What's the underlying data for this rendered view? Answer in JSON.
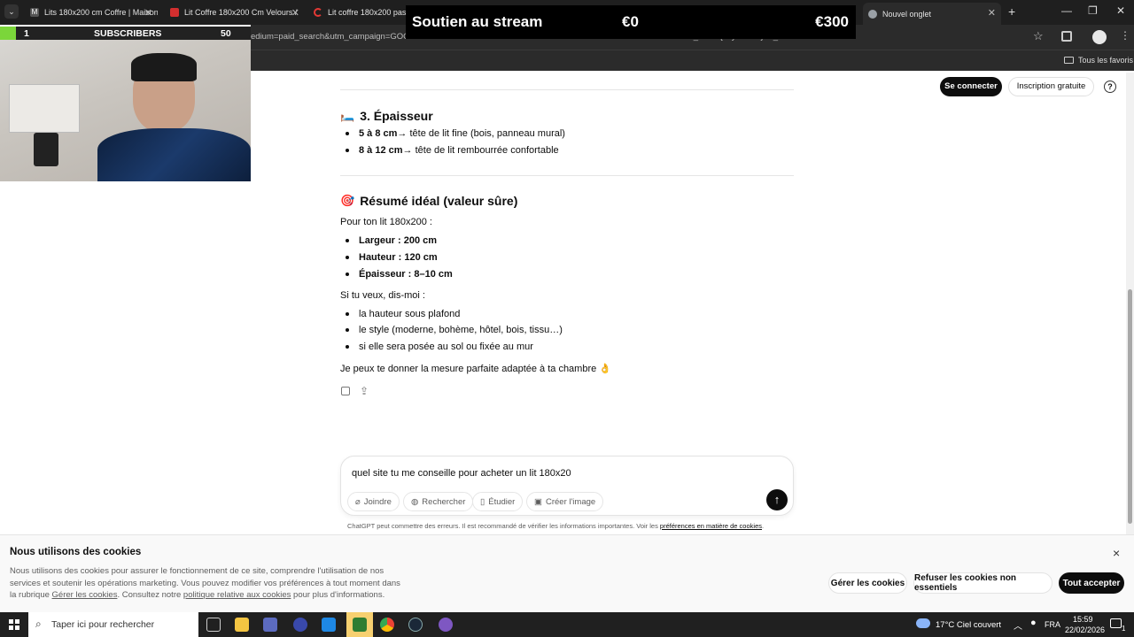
{
  "browser": {
    "tabs": [
      {
        "title": "Lits 180x200 cm Coffre | Maison"
      },
      {
        "title": "Lit Coffre 180x200 Cm Velours /"
      },
      {
        "title": "Lit coffre 180x200 pas cher"
      },
      {
        "title": "Nouvel onglet"
      }
    ],
    "new_tab": "+",
    "url": "edium=paid_search&utm_campaign=GOO...........................................................................................=785793562683&c_kwid={keywordid}&c_i...",
    "favorites_label": "Tous les favoris"
  },
  "overlay": {
    "donation_title": "Soutien au stream",
    "donation_current": "€0",
    "donation_goal": "€300",
    "subs_left": "1",
    "subs_label": "SUBSCRIBERS",
    "subs_right": "50",
    "subs_progress": 0.02
  },
  "header": {
    "login": "Se connecter",
    "signup": "Inscription gratuite",
    "help_icon": "?"
  },
  "content": {
    "section3_emoji": "🛏️",
    "section3_title": "3. Épaisseur",
    "section3_items": [
      {
        "bold": "5 à 8 cm",
        "rest": " → tête de lit fine (bois, panneau mural)"
      },
      {
        "bold": "8 à 12 cm",
        "rest": " → tête de lit rembourrée confortable"
      }
    ],
    "summary_emoji": "🎯",
    "summary_title": "Résumé idéal (valeur sûre)",
    "summary_intro": "Pour ton lit 180x200 :",
    "summary_items": [
      {
        "bold": "Largeur : 200 cm"
      },
      {
        "bold": "Hauteur : 120 cm"
      },
      {
        "bold": "Épaisseur : 8–10 cm"
      }
    ],
    "ask_intro": "Si tu veux, dis-moi :",
    "ask_items": [
      "la hauteur sous plafond",
      "le style (moderne, bohème, hôtel, bois, tissu…)",
      "si elle sera posée au sol ou fixée au mur"
    ],
    "closing": "Je peux te donner la mesure parfaite adaptée à ta chambre 👌"
  },
  "composer": {
    "value": "quel site tu me conseille pour acheter un lit 180x20",
    "tools": [
      "Joindre",
      "Rechercher",
      "Étudier",
      "Créer l'image"
    ],
    "disclaimer_main": "ChatGPT peut commettre des erreurs. Il est recommandé de vérifier les informations importantes. Voir les ",
    "disclaimer_link": "préférences en matière de cookies",
    "disclaimer_end": "."
  },
  "cookie": {
    "title": "Nous utilisons des cookies",
    "text_1": "Nous utilisons des cookies pour assurer le fonctionnement de ce site, comprendre l'utilisation de nos",
    "text_2": "services et soutenir les opérations marketing. Vous pouvez modifier vos préférences à tout moment dans",
    "text_3a": "la rubrique ",
    "link_1": "Gérer les cookies",
    "text_3b": ". Consultez notre ",
    "link_2": "politique relative aux cookies",
    "text_3c": " pour plus d'informations.",
    "manage": "Gérer les cookies",
    "reject": "Refuser les cookies non essentiels",
    "accept": "Tout accepter",
    "close": "×"
  },
  "taskbar": {
    "search_placeholder": "Taper ici pour rechercher",
    "weather": "17°C  Ciel couvert",
    "lang": "FRA",
    "time": "15:59",
    "date": "22/02/2026",
    "notif": "1"
  }
}
